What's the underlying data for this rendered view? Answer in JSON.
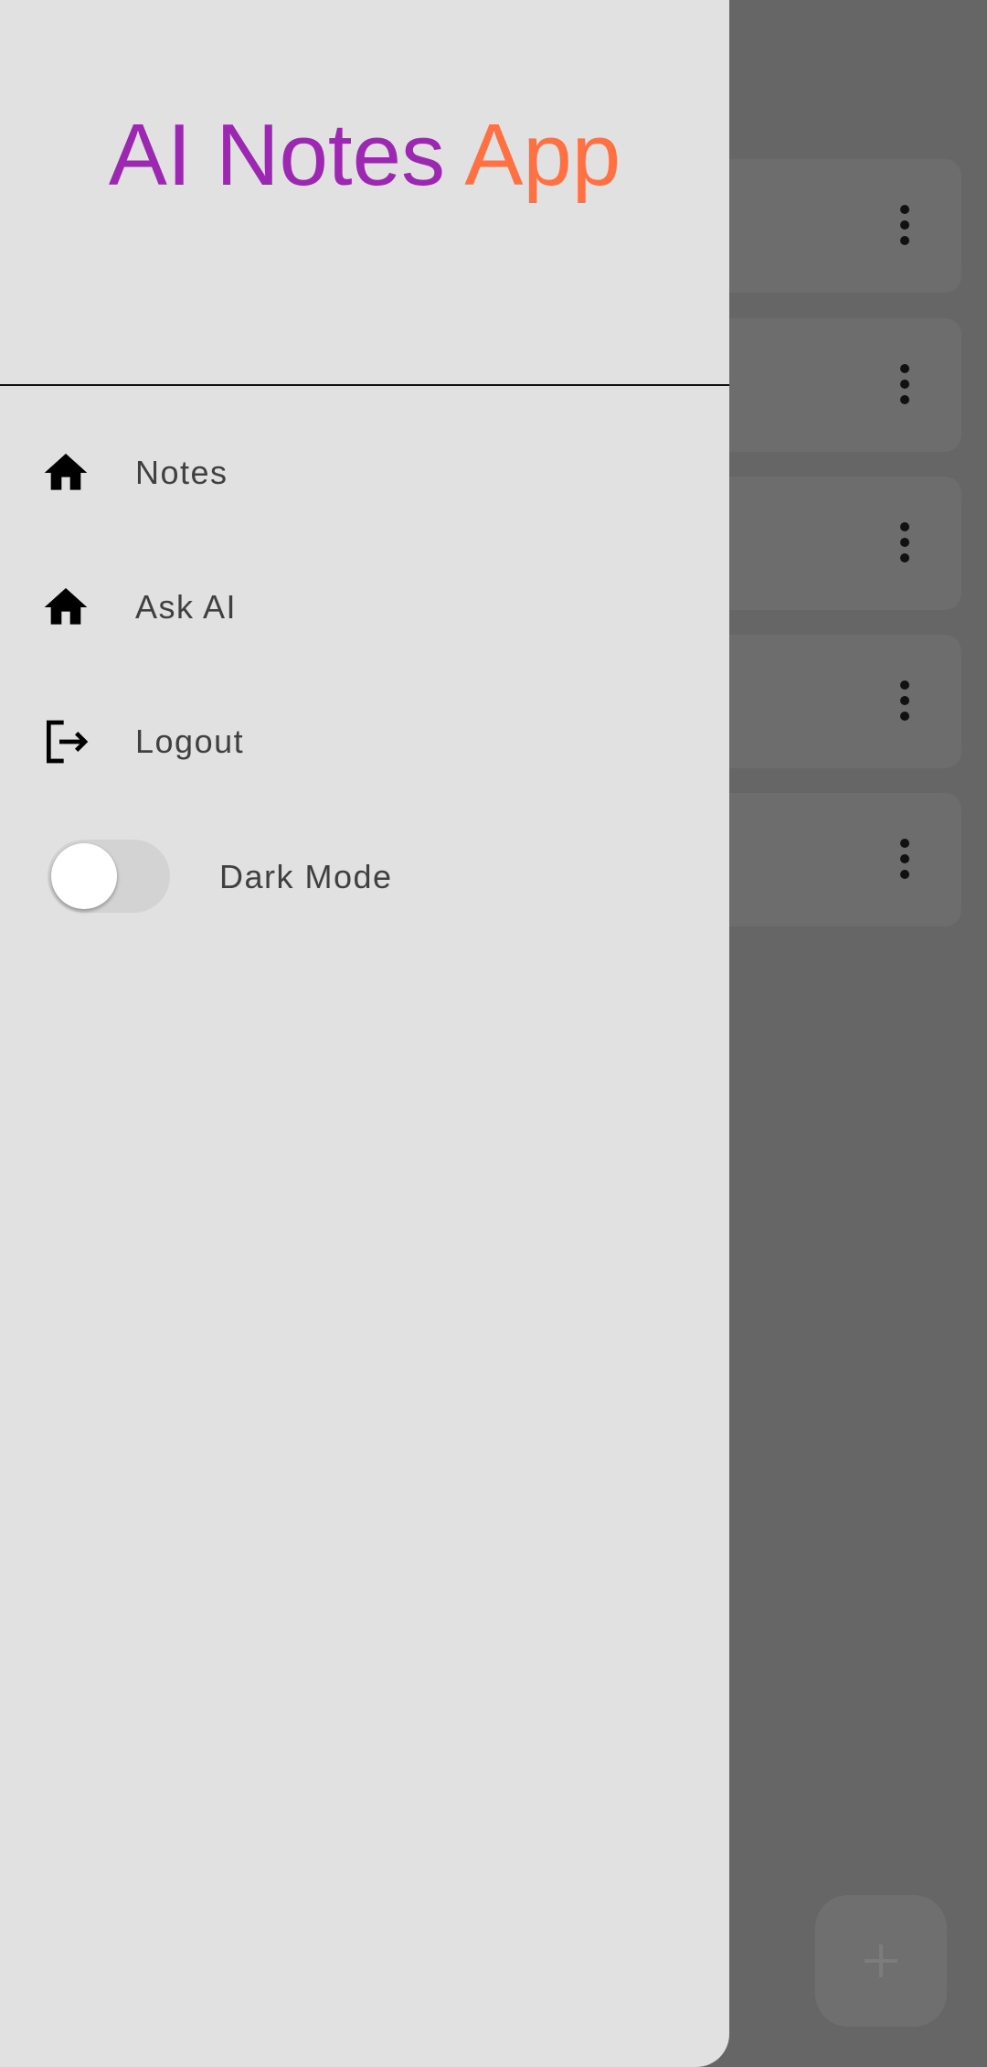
{
  "drawer": {
    "title_part_1": "AI Notes",
    "title_part_2": "App",
    "items": [
      {
        "label": "Notes",
        "icon": "home-icon"
      },
      {
        "label": "Ask AI",
        "icon": "home-icon"
      },
      {
        "label": "Logout",
        "icon": "logout-icon"
      }
    ],
    "dark_mode": {
      "label": "Dark Mode",
      "enabled": false
    }
  },
  "background": {
    "note_cards_count_visible": 5,
    "fab_icon": "plus-icon"
  },
  "colors": {
    "title_primary": "#9c27b0",
    "title_accent": "#ff7043",
    "drawer_background": "#e1e1e2",
    "scrim": "#666666"
  }
}
